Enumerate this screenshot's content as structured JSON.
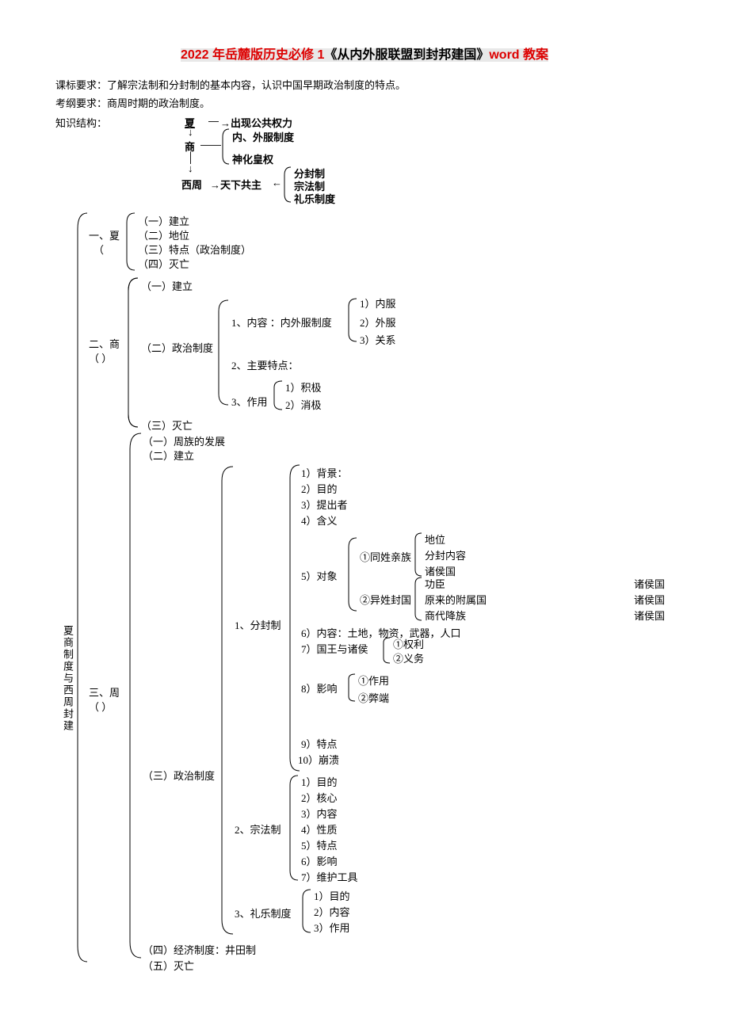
{
  "title": {
    "red1": "2022 年岳麓版历史必修 1",
    "black": "《从内外服联盟到封邦建国》",
    "red2": "word 教案"
  },
  "req1": "课标要求：了解宗法制和分封制的基本内容，认识中国早期政治制度的特点。",
  "req2": "考纲要求：商周时期的政治制度。",
  "structLabel": "知识结构：",
  "flow": {
    "xia": "夏",
    "arrow_r": "→出现公共权力",
    "shang": "商",
    "inner_outer": "内、外服制度",
    "shenhua": "神化皇权",
    "xizhou": "西周",
    "tianxia": "→天下共主",
    "ff": "分封制",
    "zf": "宗法制",
    "ly": "礼乐制度"
  },
  "vlabel": "夏商制度与西周封建",
  "s1": {
    "head": "一、夏",
    "paren": "（",
    "i1": "（一）建立",
    "i2": "（二）地位",
    "i3": "（三）特点（政治制度）",
    "i4": "（四）灭亡"
  },
  "s2": {
    "head": "二、商",
    "paren": "（        ）",
    "i1": "（一）建立",
    "i2": "（二）政治制度",
    "i3": "（三）灭亡",
    "c1": "1、内容 ：内外服制度",
    "c1a": "1）内服",
    "c1b": "2）外服",
    "c1c": "3）关系",
    "c2": "2、主要特点：",
    "c3": "3、作用",
    "c3a": "1）积极",
    "c3b": "2）消极"
  },
  "s3": {
    "head": "三、周",
    "paren": "（        ）",
    "i1": "（一）周族的发展",
    "i2": "（二）建立",
    "i3": "（三）政治制度",
    "i4": "（四）经济制度：井田制",
    "i5": "（五）灭亡",
    "f": {
      "h": "1、分封制",
      "a1": "1）背景：",
      "a2": "2）目的",
      "a3": "3）提出者",
      "a4": "4）含义",
      "a5": "5）对象",
      "a5_1": "①同姓亲族",
      "a5_1a": "地位",
      "a5_1b": "分封内容",
      "a5_1c": "诸侯国",
      "a5_2": "②异姓封国",
      "a5_2a": "功臣",
      "a5_2b": "原来的附属国",
      "a5_2c": "商代降族",
      "a5_r": "诸侯国",
      "a6": "6）内容：土地，物资，武器，人口",
      "a7": "7）国王与诸侯",
      "a7a": "①权利",
      "a7b": "②义务",
      "a8": "8）影响",
      "a8a": "①作用",
      "a8b": "②弊端",
      "a9": "9）特点",
      "a10": "10）崩溃"
    },
    "z": {
      "h": "2、宗法制",
      "b1": "1）目的",
      "b2": "2）核心",
      "b3": "3）内容",
      "b4": "4）性质",
      "b5": "5）特点",
      "b6": "6）影响",
      "b7": "7）维护工具"
    },
    "l": {
      "h": "3、礼乐制度",
      "c1": "1）目的",
      "c2": "2）内容",
      "c3": "3）作用"
    }
  }
}
